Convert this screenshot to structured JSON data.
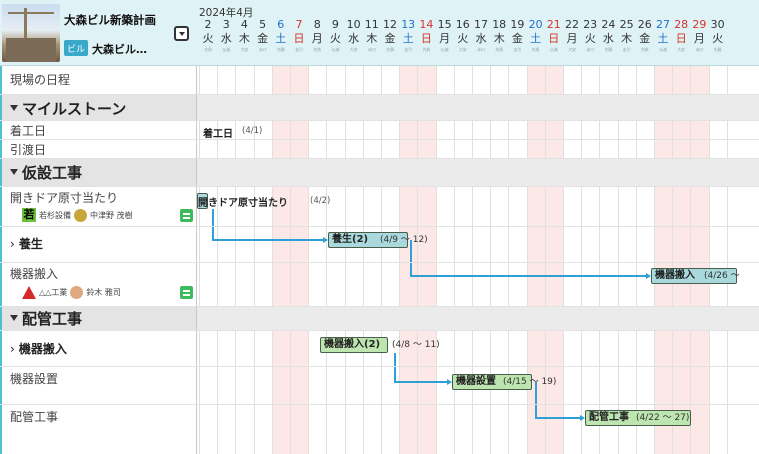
{
  "project": {
    "title": "大森ビル新築計画",
    "subtitle": "大森ビル…",
    "icon_label": "ビル",
    "menu_icon": "chevron-down-icon"
  },
  "calendar": {
    "month": "2024年4月",
    "days": [
      {
        "num": "2",
        "wd": "火",
        "tag": "先負",
        "type": "weekday"
      },
      {
        "num": "3",
        "wd": "水",
        "tag": "仏滅",
        "type": "weekday"
      },
      {
        "num": "4",
        "wd": "木",
        "tag": "大安",
        "type": "weekday"
      },
      {
        "num": "5",
        "wd": "金",
        "tag": "赤口",
        "type": "weekday"
      },
      {
        "num": "6",
        "wd": "土",
        "tag": "先勝",
        "type": "sat"
      },
      {
        "num": "7",
        "wd": "日",
        "tag": "友引",
        "type": "sun"
      },
      {
        "num": "8",
        "wd": "月",
        "tag": "先負",
        "type": "weekday"
      },
      {
        "num": "9",
        "wd": "火",
        "tag": "仏滅",
        "type": "weekday"
      },
      {
        "num": "10",
        "wd": "水",
        "tag": "大安",
        "type": "weekday"
      },
      {
        "num": "11",
        "wd": "木",
        "tag": "赤口",
        "type": "weekday"
      },
      {
        "num": "12",
        "wd": "金",
        "tag": "先勝",
        "type": "weekday"
      },
      {
        "num": "13",
        "wd": "土",
        "tag": "友引",
        "type": "sat"
      },
      {
        "num": "14",
        "wd": "日",
        "tag": "先負",
        "type": "sun"
      },
      {
        "num": "15",
        "wd": "月",
        "tag": "仏滅",
        "type": "weekday"
      },
      {
        "num": "16",
        "wd": "火",
        "tag": "大安",
        "type": "weekday"
      },
      {
        "num": "17",
        "wd": "水",
        "tag": "赤口",
        "type": "weekday"
      },
      {
        "num": "18",
        "wd": "木",
        "tag": "先勝",
        "type": "weekday"
      },
      {
        "num": "19",
        "wd": "金",
        "tag": "友引",
        "type": "weekday"
      },
      {
        "num": "20",
        "wd": "土",
        "tag": "先負",
        "type": "sat"
      },
      {
        "num": "21",
        "wd": "日",
        "tag": "仏滅",
        "type": "sun"
      },
      {
        "num": "22",
        "wd": "月",
        "tag": "大安",
        "type": "weekday"
      },
      {
        "num": "23",
        "wd": "火",
        "tag": "赤口",
        "type": "weekday"
      },
      {
        "num": "24",
        "wd": "水",
        "tag": "先勝",
        "type": "weekday"
      },
      {
        "num": "25",
        "wd": "木",
        "tag": "友引",
        "type": "weekday"
      },
      {
        "num": "26",
        "wd": "金",
        "tag": "先負",
        "type": "weekday"
      },
      {
        "num": "27",
        "wd": "土",
        "tag": "仏滅",
        "type": "sat"
      },
      {
        "num": "28",
        "wd": "日",
        "tag": "大安",
        "type": "sun"
      },
      {
        "num": "29",
        "wd": "月",
        "tag": "赤口",
        "type": "hol"
      },
      {
        "num": "30",
        "wd": "火",
        "tag": "先勝",
        "type": "weekday"
      }
    ]
  },
  "rows": {
    "site_schedule": "現場の日程",
    "milestones": "マイルストーン",
    "start": "着工日",
    "handover": "引渡日",
    "temp_works": "仮設工事",
    "door_fit": "開きドア原寸当たり",
    "door_fit_company": "若杉設備",
    "door_fit_person": "中津野 茂樹",
    "curing_group": "養生",
    "equip_in": "機器搬入",
    "equip_in_company": "△△工業",
    "equip_in_person": "鈴木 雅司",
    "piping_works": "配管工事",
    "equip_in_group": "機器搬入",
    "equip_install": "機器設置",
    "piping": "配管工事"
  },
  "bars": {
    "start_label": "着工日",
    "start_range": "(4/1)",
    "door_label": "開きドア原寸当たり",
    "door_range": "(4/2)",
    "curing_label": "養生(2)",
    "curing_range": "(4/9 ～ 12)",
    "equip_label": "機器搬入",
    "equip_range": "(4/26 ～",
    "equip_grp_label": "機器搬入(2)",
    "equip_grp_range": "(4/8 ～ 11)",
    "install_label": "機器設置",
    "install_range": "(4/15 ～ 19)",
    "pipe_label": "配管工事",
    "pipe_range": "(4/22 ～ 27)"
  },
  "colors": {
    "accent": "#4fc1cc",
    "header_bg": "#dff2f5",
    "weekend_bg": "#fde8e8",
    "bar_teal": "#a9d9dc",
    "bar_green": "#bde5b0",
    "link": "#2f9fd6"
  }
}
